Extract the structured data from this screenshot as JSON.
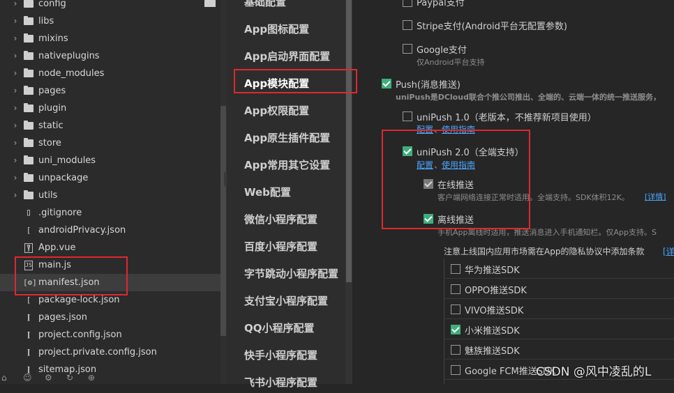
{
  "file_tree": {
    "items": [
      {
        "name": "config",
        "kind": "folder"
      },
      {
        "name": "libs",
        "kind": "folder"
      },
      {
        "name": "mixins",
        "kind": "folder"
      },
      {
        "name": "nativeplugins",
        "kind": "folder"
      },
      {
        "name": "node_modules",
        "kind": "folder"
      },
      {
        "name": "pages",
        "kind": "folder"
      },
      {
        "name": "plugin",
        "kind": "folder"
      },
      {
        "name": "static",
        "kind": "folder"
      },
      {
        "name": "store",
        "kind": "folder"
      },
      {
        "name": "uni_modules",
        "kind": "folder"
      },
      {
        "name": "unpackage",
        "kind": "folder"
      },
      {
        "name": "utils",
        "kind": "folder"
      },
      {
        "name": ".gitignore",
        "kind": "file"
      },
      {
        "name": "androidPrivacy.json",
        "kind": "json"
      },
      {
        "name": "App.vue",
        "kind": "vue"
      },
      {
        "name": "main.js",
        "kind": "js"
      },
      {
        "name": "manifest.json",
        "kind": "manifest"
      },
      {
        "name": "package-lock.json",
        "kind": "json"
      },
      {
        "name": "pages.json",
        "kind": "json"
      },
      {
        "name": "project.config.json",
        "kind": "json"
      },
      {
        "name": "project.private.config.json",
        "kind": "json"
      },
      {
        "name": "sitemap.json",
        "kind": "json"
      }
    ],
    "selected": "manifest.json",
    "collapse_icon": "‹"
  },
  "nav": {
    "items": [
      "基础配置",
      "App图标配置",
      "App启动界面配置",
      "App模块配置",
      "App权限配置",
      "App原生插件配置",
      "App常用其它设置",
      "Web配置",
      "微信小程序配置",
      "百度小程序配置",
      "字节跳动小程序配置",
      "支付宝小程序配置",
      "QQ小程序配置",
      "快手小程序配置",
      "飞书小程序配置"
    ],
    "active": "App模块配置"
  },
  "settings": {
    "paypal": "Paypal支付",
    "stripe": "Stripe支付(Android平台无配置参数)",
    "google_pay": "Google支付",
    "google_pay_desc": "仅Android平台支持",
    "push": "Push(消息推送)",
    "push_desc": "uniPush是DCloud联合个推公司推出、全端的、云端一体的统一推送服务，",
    "unipush1": "uniPush 1.0（老版本，不推荐新项目使用）",
    "unipush1_link_config": "配置",
    "unipush1_link_guide": "使用指南",
    "unipush2": "uniPush 2.0（全端支持）",
    "unipush2_link_config": "配置",
    "unipush2_link_guide": "使用指南",
    "link_sep": "、",
    "online": "在线推送",
    "online_desc": "客户端网络连接正常时适用。全端支持。SDK体积12K。",
    "online_detail": "[详情]",
    "offline": "离线推送",
    "offline_desc": "手机App离线时适用，推送消息进入手机通知栏。仅App支持。S",
    "privacy_note": "注意上线国内应用市场需在App的隐私协议中添加条款",
    "privacy_link": "[详",
    "sdks": [
      {
        "label": "华为推送SDK",
        "checked": false
      },
      {
        "label": "OPPO推送SDK",
        "checked": false
      },
      {
        "label": "VIVO推送SDK",
        "checked": false
      },
      {
        "label": "小米推送SDK",
        "checked": true
      },
      {
        "label": "魅族推送SDK",
        "checked": false
      },
      {
        "label": "Google FCM推送SDK",
        "checked": false
      }
    ]
  },
  "watermark": "CSDN @风中凌乱的L",
  "bottom_icons": [
    "⌂",
    "☺",
    "⚙",
    "↻",
    "⊕"
  ],
  "colors": {
    "accent_green": "#3eaf7c",
    "link_blue": "#4aa8ff",
    "highlight_red": "#e0282e"
  }
}
